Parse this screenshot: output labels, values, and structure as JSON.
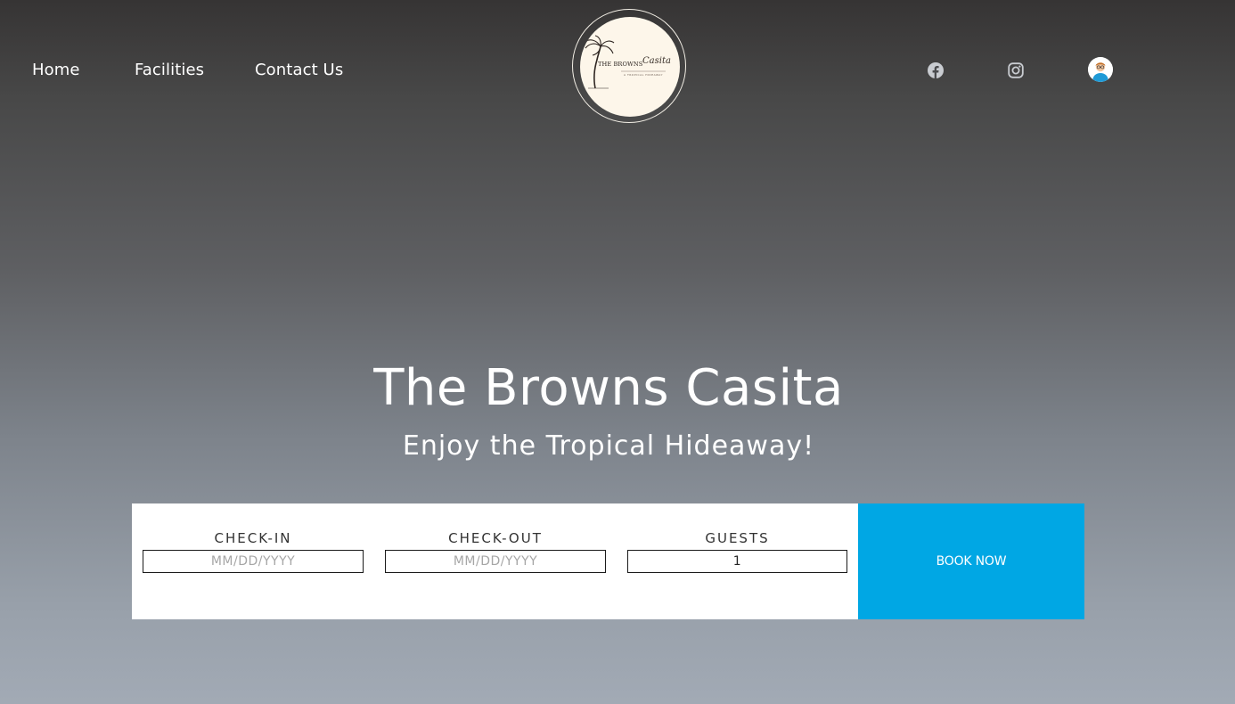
{
  "nav": {
    "items": [
      {
        "label": "Home"
      },
      {
        "label": "Facilities"
      },
      {
        "label": "Contact Us"
      }
    ]
  },
  "logo": {
    "main_text": "THE BROWNS",
    "script_text": "Casita",
    "sub_text": "A TROPICAL HIDEAWAY",
    "icon": "palm-tree"
  },
  "social": {
    "icons": [
      "facebook-icon",
      "instagram-icon",
      "user-avatar"
    ]
  },
  "hero": {
    "title": "The Browns Casita",
    "subtitle": "Enjoy the Tropical Hideaway!"
  },
  "booking": {
    "checkin": {
      "label": "CHECK-IN",
      "placeholder": "MM/DD/YYYY",
      "value": ""
    },
    "checkout": {
      "label": "CHECK-OUT",
      "placeholder": "MM/DD/YYYY",
      "value": ""
    },
    "guests": {
      "label": "GUESTS",
      "value": "1"
    },
    "button_label": "BOOK NOW"
  },
  "colors": {
    "accent": "#00a7e4",
    "booking_bg": "#ffffff",
    "text_light": "#ffffff"
  }
}
